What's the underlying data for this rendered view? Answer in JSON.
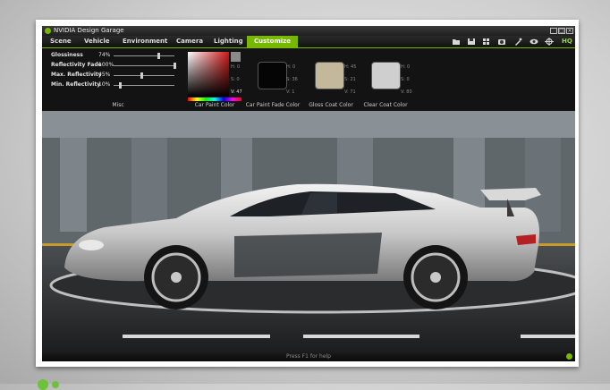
{
  "window": {
    "title": "NVIDIA Design Garage",
    "minimize": "_",
    "maximize": "□",
    "close": "×"
  },
  "menu": {
    "tabs": [
      "Scene",
      "Vehicle",
      "Environment",
      "Camera",
      "Lighting",
      "Customize"
    ],
    "active": "Customize",
    "hq_label": "HQ"
  },
  "customize": {
    "sliders": [
      {
        "label": "Glossiness",
        "value": "74%",
        "level": 0.74
      },
      {
        "label": "Reflectivity Fade",
        "value": "100%",
        "level": 1.0
      },
      {
        "label": "Max. Reflectivity",
        "value": "45%",
        "level": 0.45
      },
      {
        "label": "Min. Reflectivity",
        "value": "10%",
        "level": 0.1
      }
    ],
    "misc_label": "Misc",
    "colors": {
      "car_paint": {
        "label": "Car Paint Color",
        "h": "H: 0",
        "s": "S: 0",
        "v": "V: 47",
        "hex": "#d01818"
      },
      "car_paint_fade": {
        "label": "Car Paint Fade Color",
        "h": "H: 0",
        "s": "S: 36",
        "v": "V: 1",
        "hex": "#050505"
      },
      "gloss_coat": {
        "label": "Gloss Coat Color",
        "h": "H: 45",
        "s": "S: 21",
        "v": "V: 71",
        "hex": "#c4b89a"
      },
      "clear_coat": {
        "label": "Clear Coat Color",
        "h": "H: 0",
        "s": "S: 0",
        "v": "V: 80",
        "hex": "#cfcfcf"
      }
    }
  },
  "status": {
    "help_text": "Press F1 for help"
  },
  "colors": {
    "accent": "#76b900"
  }
}
